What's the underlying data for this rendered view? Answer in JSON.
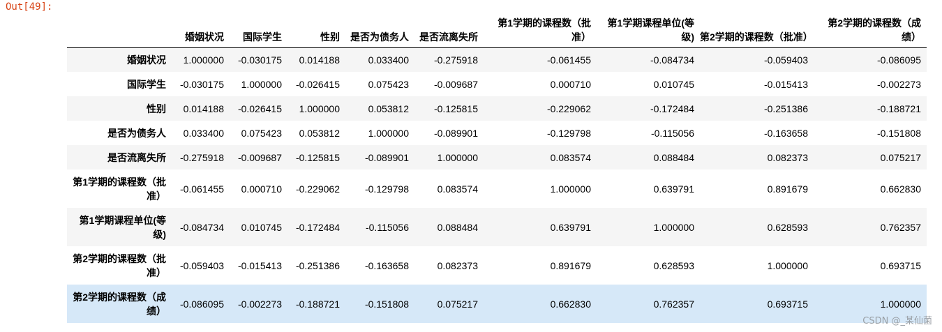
{
  "prompt": "Out[49]:",
  "columns": [
    "婚姻状况",
    "国际学生",
    "性别",
    "是否为债务人",
    "是否流离失所",
    "第1学期的课程数（批准）",
    "第1学期课程单位(等级)",
    "第2学期的课程数（批准）",
    "第2学期的课程数（成绩）"
  ],
  "rows": [
    {
      "label": "婚姻状况",
      "values": [
        "1.000000",
        "-0.030175",
        "0.014188",
        "0.033400",
        "-0.275918",
        "-0.061455",
        "-0.084734",
        "-0.059403",
        "-0.086095"
      ]
    },
    {
      "label": "国际学生",
      "values": [
        "-0.030175",
        "1.000000",
        "-0.026415",
        "0.075423",
        "-0.009687",
        "0.000710",
        "0.010745",
        "-0.015413",
        "-0.002273"
      ]
    },
    {
      "label": "性别",
      "values": [
        "0.014188",
        "-0.026415",
        "1.000000",
        "0.053812",
        "-0.125815",
        "-0.229062",
        "-0.172484",
        "-0.251386",
        "-0.188721"
      ]
    },
    {
      "label": "是否为债务人",
      "values": [
        "0.033400",
        "0.075423",
        "0.053812",
        "1.000000",
        "-0.089901",
        "-0.129798",
        "-0.115056",
        "-0.163658",
        "-0.151808"
      ]
    },
    {
      "label": "是否流离失所",
      "values": [
        "-0.275918",
        "-0.009687",
        "-0.125815",
        "-0.089901",
        "1.000000",
        "0.083574",
        "0.088484",
        "0.082373",
        "0.075217"
      ]
    },
    {
      "label": "第1学期的课程数（批准）",
      "values": [
        "-0.061455",
        "0.000710",
        "-0.229062",
        "-0.129798",
        "0.083574",
        "1.000000",
        "0.639791",
        "0.891679",
        "0.662830"
      ]
    },
    {
      "label": "第1学期课程单位(等级)",
      "values": [
        "-0.084734",
        "0.010745",
        "-0.172484",
        "-0.115056",
        "0.088484",
        "0.639791",
        "1.000000",
        "0.628593",
        "0.762357"
      ]
    },
    {
      "label": "第2学期的课程数（批准）",
      "values": [
        "-0.059403",
        "-0.015413",
        "-0.251386",
        "-0.163658",
        "0.082373",
        "0.891679",
        "0.628593",
        "1.000000",
        "0.693715"
      ]
    },
    {
      "label": "第2学期的课程数（成绩）",
      "values": [
        "-0.086095",
        "-0.002273",
        "-0.188721",
        "-0.151808",
        "0.075217",
        "0.662830",
        "0.762357",
        "0.693715",
        "1.000000"
      ]
    }
  ],
  "watermark": "CSDN @_某仙菌",
  "highlight_color": "#d6e8f8",
  "prompt_color": "#d84315"
}
